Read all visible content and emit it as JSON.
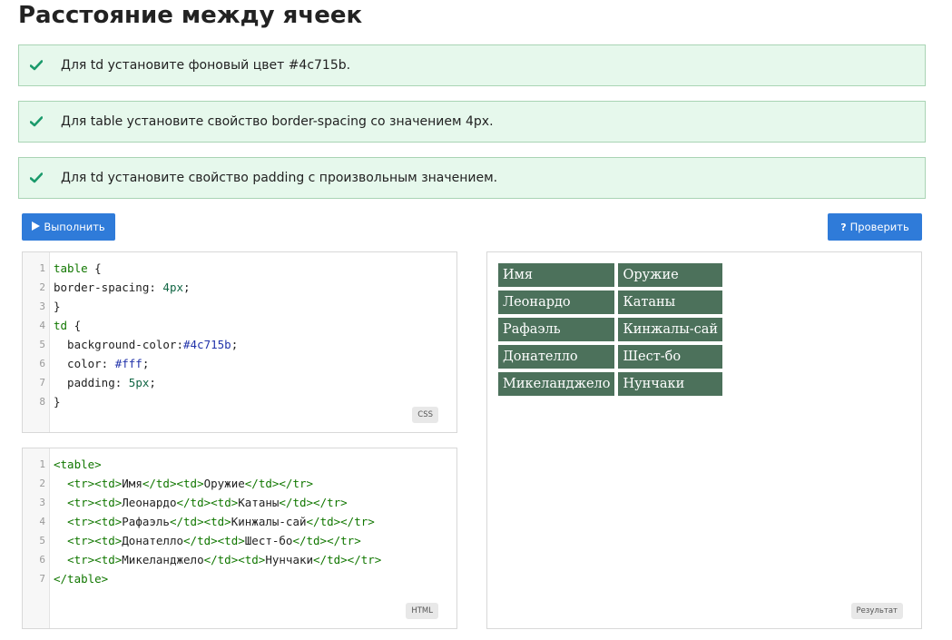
{
  "title": "Расстояние между ячеек",
  "tasks": [
    {
      "text": "Для td установите фоновый цвет #4c715b."
    },
    {
      "text": "Для table установите свойство border-spacing со значением 4px."
    },
    {
      "text": "Для td установите свойство padding с произвольным значением."
    }
  ],
  "buttons": {
    "run": {
      "label": "Выполнить",
      "icon": "play-icon"
    },
    "check": {
      "label": "Проверить",
      "icon": "question-icon"
    }
  },
  "css_editor": {
    "badge": "CSS",
    "line_numbers": [
      "1",
      "2",
      "3",
      "4",
      "5",
      "6",
      "7",
      "8"
    ],
    "lines": [
      "table {",
      "border-spacing: 4px;",
      "}",
      "td {",
      "  background-color:#4c715b;",
      "  color: #fff;",
      "  padding: 5px;",
      "}"
    ]
  },
  "html_editor": {
    "badge": "HTML",
    "line_numbers": [
      "1",
      "2",
      "3",
      "4",
      "5",
      "6",
      "7"
    ],
    "lines": [
      "<table>",
      "  <tr><td>Имя</td><td>Оружие</td></tr>",
      "  <tr><td>Леонардо</td><td>Катаны</td></tr>",
      "  <tr><td>Рафаэль</td><td>Кинжалы-сай</td></tr>",
      "  <tr><td>Донателло</td><td>Шест-бо</td></tr>",
      "  <tr><td>Микеланджело</td><td>Нунчаки</td></tr>",
      "</table>"
    ]
  },
  "result": {
    "badge": "Результат",
    "rows": [
      [
        "Имя",
        "Оружие"
      ],
      [
        "Леонардо",
        "Катаны"
      ],
      [
        "Рафаэль",
        "Кинжалы-сай"
      ],
      [
        "Донателло",
        "Шест-бо"
      ],
      [
        "Микеланджело",
        "Нунчаки"
      ]
    ]
  },
  "colors": {
    "accent": "#2f7bd9",
    "success_bg": "#e6f8ec",
    "success_border": "#a9d4b4",
    "check": "#1a9a6b",
    "cell_bg": "#4c715b"
  }
}
